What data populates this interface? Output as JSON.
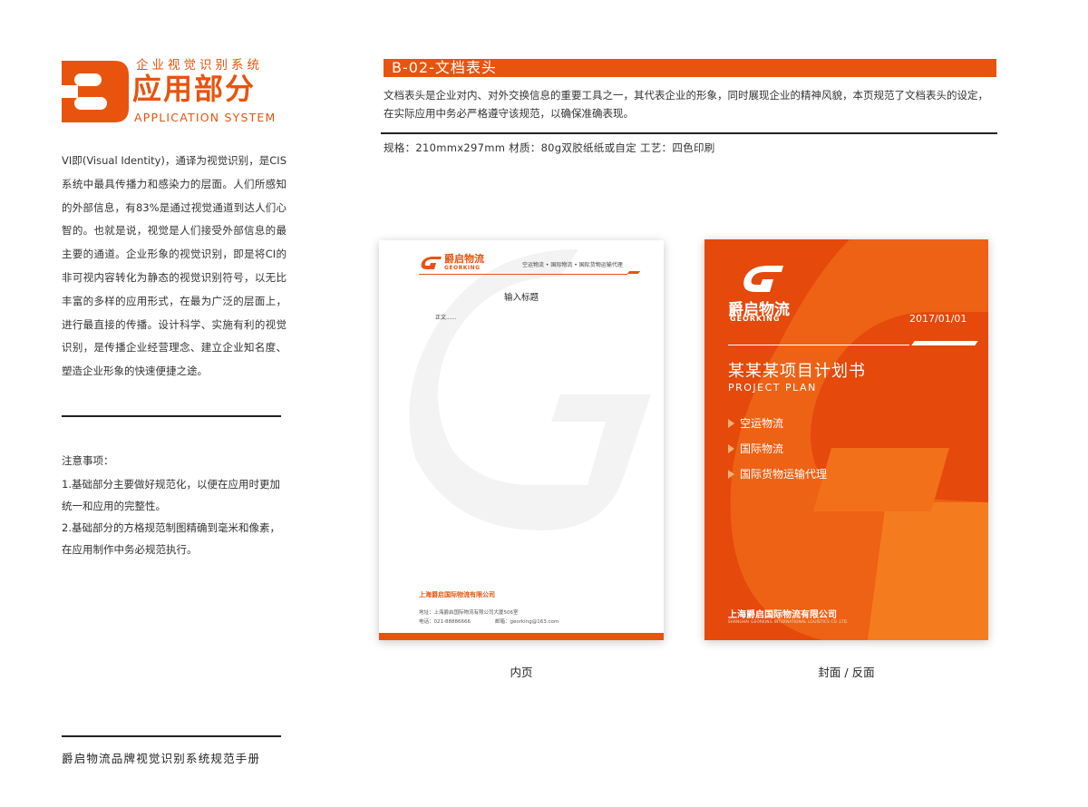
{
  "header": {
    "logo_letter": "B",
    "subtitle": "企业视觉识别系统",
    "title": "应用部分",
    "title_en": "APPLICATION SYSTEM"
  },
  "left": {
    "intro": "VI即(Visual Identity)，通译为视觉识别，是CIS系统中最具传播力和感染力的层面。人们所感知的外部信息，有83%是通过视觉通道到达人们心智的。也就是说，视觉是人们接受外部信息的最主要的通道。企业形象的视觉识别，即是将CI的非可视内容转化为静态的视觉识别符号，以无比丰富的多样的应用形式，在最为广泛的层面上，进行最直接的传播。设计科学、实施有利的视觉识别，是传播企业经营理念、建立企业知名度、塑造企业形象的快速便捷之途。",
    "notes_title": "注意事项：",
    "notes": [
      "1.基础部分主要做好规范化，以便在应用时更加统一和应用的完整性。",
      "2.基础部分的方格规范制图精确到毫米和像素，在应用制作中务必规范执行。"
    ],
    "footer": "爵启物流品牌视觉识别系统规范手册"
  },
  "section": {
    "title": "B-02-文档表头",
    "description": "文档表头是企业对内、对外交换信息的重要工具之一，其代表企业的形象，同时展现企业的精神风貌，本页规范了文档表头的设定，在实际应用中务必严格遵守该规范，以确保准确表现。",
    "specs": "规格：210mmx297mm  材质：80g双胶纸纸或自定   工艺：四色印刷"
  },
  "inner_page": {
    "brand": "爵启物流",
    "brand_en": "GEORKING",
    "services": "空运物流 • 国际物流 • 国际货物运输代理",
    "title": "输入标题",
    "body": "正文......",
    "company": "上海爵启国际物流有限公司",
    "address": "地址：上海爵启国际物流有限公司大厦506室",
    "tel": "电话：021-88886666",
    "email": "邮箱：georking@163.com",
    "caption": "内页"
  },
  "cover": {
    "brand": "爵启物流",
    "brand_en": "GEORKING",
    "date": "2017/01/01",
    "title": "某某某项目计划书",
    "title_en": "PROJECT PLAN",
    "items": [
      "空运物流",
      "国际物流",
      "国际货物运输代理"
    ],
    "company": "上海爵启国际物流有限公司",
    "company_en": "SHANGHAI GEORKING INTERNATIONAL LOGISTICS CO.,LTD.",
    "caption": "封面 / 反面"
  },
  "colors": {
    "accent": "#e8540e",
    "cover_orange": "#e5490b",
    "text": "#222222"
  }
}
